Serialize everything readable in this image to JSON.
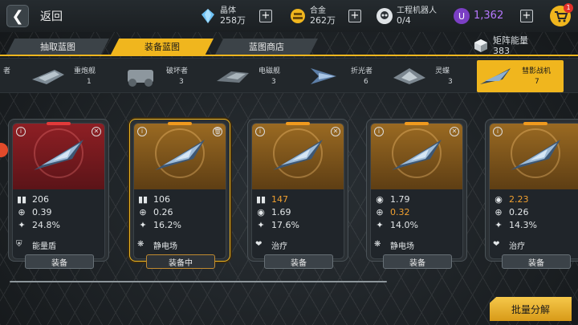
{
  "header": {
    "back_label": "返回"
  },
  "resources": [
    {
      "name": "晶体",
      "value": "258万",
      "color": "#7ecbff",
      "icon": "crystal-icon"
    },
    {
      "name": "合金",
      "value": "262万",
      "color": "#f0b61e",
      "icon": "alloy-icon"
    },
    {
      "name": "工程机器人",
      "value": "0/4",
      "color": "#dfe3e6",
      "icon": "robot-icon"
    },
    {
      "name": "",
      "value": "1,362",
      "color": "#b778ff",
      "icon": "u-currency-icon"
    }
  ],
  "cart": {
    "badge": "1"
  },
  "tabs": [
    {
      "label": "抽取蓝图"
    },
    {
      "label": "装备蓝图"
    },
    {
      "label": "蓝图商店"
    }
  ],
  "matrix": {
    "label": "矩阵能量",
    "value": "383"
  },
  "strip": {
    "edge_label": "者",
    "ships": [
      {
        "name": "重炮舰",
        "count": "1"
      },
      {
        "name": "破坏者",
        "count": "3"
      },
      {
        "name": "电磁舰",
        "count": "3"
      },
      {
        "name": "折光者",
        "count": "6"
      },
      {
        "name": "灵蝶",
        "count": "3"
      },
      {
        "name": "彗影战机",
        "count": "7"
      }
    ]
  },
  "cards": [
    {
      "rarity": "red",
      "stats": [
        {
          "icon": "ammo-icon",
          "v": "206",
          "hl": false
        },
        {
          "icon": "crosshair-icon",
          "v": "0.39",
          "hl": false
        },
        {
          "icon": "crit-icon",
          "v": "24.8%",
          "hl": false
        }
      ],
      "ability_icon": "shield-icon",
      "ability": "能量盾",
      "button": "装备"
    },
    {
      "rarity": "gold",
      "stats": [
        {
          "icon": "ammo-icon",
          "v": "106",
          "hl": false
        },
        {
          "icon": "crosshair-icon",
          "v": "0.26",
          "hl": false
        },
        {
          "icon": "crit-icon",
          "v": "16.2%",
          "hl": false
        }
      ],
      "ability_icon": "static-icon",
      "ability": "静电场",
      "button": "装备中"
    },
    {
      "rarity": "gold",
      "stats": [
        {
          "icon": "ammo-icon",
          "v": "147",
          "hl": true
        },
        {
          "icon": "dial-icon",
          "v": "1.69",
          "hl": false
        },
        {
          "icon": "crit-icon",
          "v": "17.6%",
          "hl": false
        }
      ],
      "ability_icon": "heal-icon",
      "ability": "治疗",
      "button": "装备"
    },
    {
      "rarity": "gold",
      "stats": [
        {
          "icon": "dial-icon",
          "v": "1.79",
          "hl": false
        },
        {
          "icon": "crosshair-icon",
          "v": "0.32",
          "hl": true
        },
        {
          "icon": "crit-icon",
          "v": "14.0%",
          "hl": false
        }
      ],
      "ability_icon": "static-icon",
      "ability": "静电场",
      "button": "装备"
    },
    {
      "rarity": "gold",
      "stats": [
        {
          "icon": "dial-icon",
          "v": "2.23",
          "hl": true
        },
        {
          "icon": "crosshair-icon",
          "v": "0.26",
          "hl": false
        },
        {
          "icon": "crit-icon",
          "v": "14.3%",
          "hl": false
        }
      ],
      "ability_icon": "heal-icon",
      "ability": "治疗",
      "button": "装备"
    }
  ],
  "batch_button": "批量分解"
}
